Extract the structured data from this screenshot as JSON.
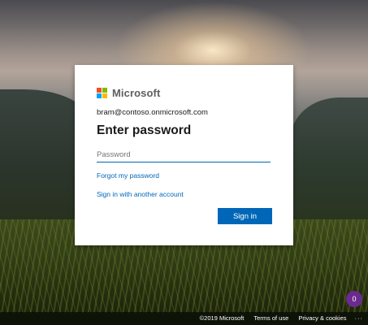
{
  "brand": {
    "name": "Microsoft",
    "logo_colors": [
      "#f25022",
      "#7fba00",
      "#00a4ef",
      "#ffb900"
    ]
  },
  "signin": {
    "email": "bram@contoso.onmicrosoft.com",
    "title": "Enter password",
    "password_placeholder": "Password",
    "password_value": "",
    "forgot_link": "Forgot my password",
    "another_account_link": "Sign in with another account",
    "button_label": "Sign in"
  },
  "footer": {
    "copyright": "©2019 Microsoft",
    "terms": "Terms of use",
    "privacy": "Privacy & cookies",
    "more": "···"
  },
  "badge": {
    "count": "0"
  },
  "colors": {
    "accent": "#0067b8",
    "badge": "#6b2a8f"
  }
}
